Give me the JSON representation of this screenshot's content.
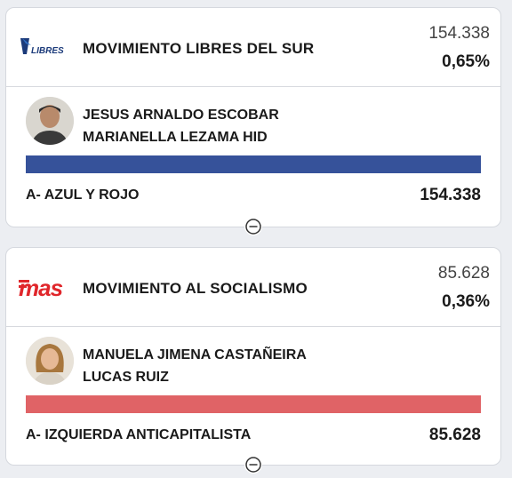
{
  "cards": [
    {
      "logo_text": "LIBRES",
      "party": "MOVIMIENTO LIBRES DEL SUR",
      "votes": "154.338",
      "percent": "0,65%",
      "candidate_1": "JESUS ARNALDO ESCOBAR",
      "candidate_2": "MARIANELLA LEZAMA HID",
      "list": "A- AZUL Y ROJO",
      "list_votes": "154.338",
      "bar_color": "#36529a"
    },
    {
      "logo_text": "mas",
      "party": "MOVIMIENTO AL SOCIALISMO",
      "votes": "85.628",
      "percent": "0,36%",
      "candidate_1": "MANUELA JIMENA CASTAÑEIRA",
      "candidate_2": "LUCAS RUIZ",
      "list": "A- IZQUIERDA ANTICAPITALISTA",
      "list_votes": "85.628",
      "bar_color": "#e06366"
    }
  ]
}
